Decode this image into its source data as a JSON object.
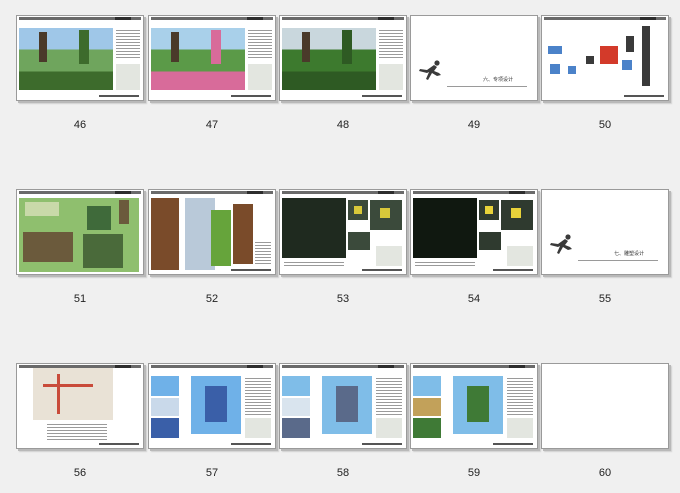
{
  "slides": [
    {
      "number": "46",
      "kind": "photo-wide",
      "colors": [
        "#6fa55d",
        "#9fc7e8",
        "#3d6b2c"
      ]
    },
    {
      "number": "47",
      "kind": "photo-wide",
      "colors": [
        "#5b9a48",
        "#a9d0ea",
        "#d86b9a"
      ]
    },
    {
      "number": "48",
      "kind": "photo-wide",
      "colors": [
        "#3d7a2e",
        "#c9d7dd",
        "#2e5a23"
      ]
    },
    {
      "number": "49",
      "kind": "section",
      "caption": "六、专项设计"
    },
    {
      "number": "50",
      "kind": "diagram",
      "colors": [
        "#4b82c9",
        "#d33a2a",
        "#3a3a3a"
      ]
    },
    {
      "number": "51",
      "kind": "plan",
      "colors": [
        "#8fbf6e",
        "#6b5a3c",
        "#c9d9a9"
      ]
    },
    {
      "number": "52",
      "kind": "elevation",
      "colors": [
        "#7a4b2a",
        "#66a43b",
        "#b9c9d9"
      ]
    },
    {
      "number": "53",
      "kind": "night",
      "colors": [
        "#1f2a1f",
        "#d8c83a",
        "#3b4a3b"
      ]
    },
    {
      "number": "54",
      "kind": "night",
      "colors": [
        "#101810",
        "#e8d23a",
        "#2f3a2f"
      ]
    },
    {
      "number": "55",
      "kind": "section",
      "caption": "七、雕塑设计"
    },
    {
      "number": "56",
      "kind": "map",
      "colors": [
        "#e9e2d6",
        "#5a9bd6",
        "#c94b3a"
      ]
    },
    {
      "number": "57",
      "kind": "sculpture",
      "colors": [
        "#6fb1e8",
        "#3a5fa8",
        "#c9d9ea"
      ]
    },
    {
      "number": "58",
      "kind": "sculpture",
      "colors": [
        "#7fbde8",
        "#5a6a8a",
        "#d9e4ee"
      ]
    },
    {
      "number": "59",
      "kind": "sculpture",
      "colors": [
        "#7fbde8",
        "#3f7a36",
        "#c2a15a"
      ]
    },
    {
      "number": "60",
      "kind": "blank"
    }
  ]
}
